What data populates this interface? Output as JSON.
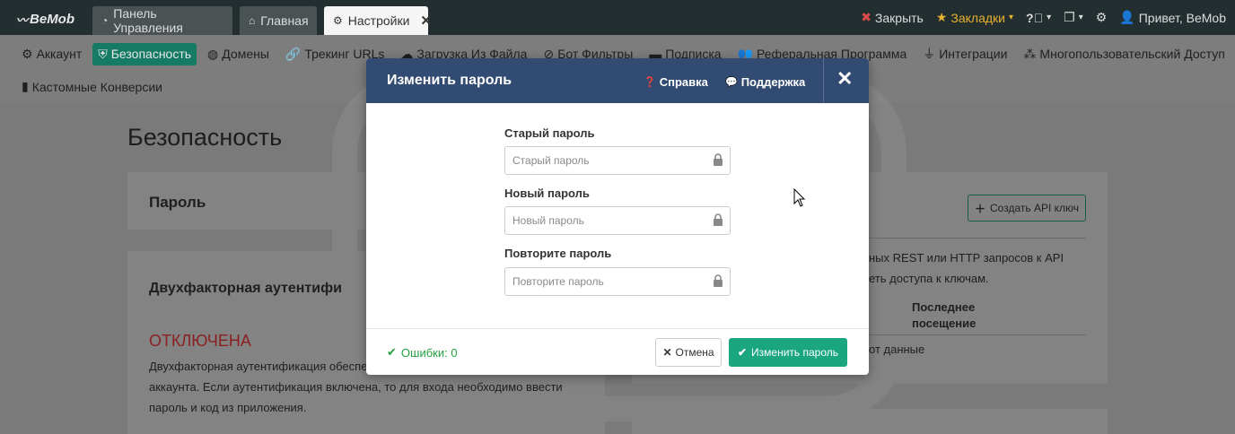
{
  "app": {
    "logo": "BeMob"
  },
  "tabs": [
    {
      "label": "Панель Управления",
      "icon": "dashboard-icon"
    },
    {
      "label": "Главная",
      "icon": "home-icon"
    },
    {
      "label": "Настройки",
      "icon": "gear-icon",
      "active": true
    }
  ],
  "topright": {
    "close_label": "Закрыть",
    "bookmarks_label": "Закладки",
    "greeting": "Привет, BeMob"
  },
  "subnav": [
    {
      "label": "Аккаунт",
      "icon": "gear-icon"
    },
    {
      "label": "Безопасность",
      "icon": "shield-icon",
      "active": true
    },
    {
      "label": "Домены",
      "icon": "globe-icon"
    },
    {
      "label": "Трекинг URLs",
      "icon": "link-icon"
    },
    {
      "label": "Загрузка Из Файла",
      "icon": "cloud-upload-icon"
    },
    {
      "label": "Бот Фильтры",
      "icon": "ban-icon"
    },
    {
      "label": "Подписка",
      "icon": "credit-card-icon"
    },
    {
      "label": "Реферальная Программа",
      "icon": "users-icon"
    },
    {
      "label": "Интеграции",
      "icon": "plug-icon"
    },
    {
      "label": "Многопользовательский Доступ",
      "icon": "sitemap-icon"
    },
    {
      "label": "Кастомные Конверсии",
      "icon": "file-icon"
    }
  ],
  "page": {
    "title": "Безопасность",
    "password_card_title": "Пароль",
    "twofa_title": "Двухфакторная аутентифи",
    "twofa_status": "ОТКЛЮЧЕНА",
    "twofa_text_1": "Двухфакторная аутентификация обеспе",
    "twofa_text_2": "аккаунта. Если аутентификация включена, то для входа необходимо ввести",
    "twofa_text_3": "пароль и код из приложения.",
    "api_button": "Создать API ключ",
    "api_text_1": "ных REST или HTTP запросов к API",
    "api_text_2": "еть доступа к ключам.",
    "api_col_last_1": "Последнее",
    "api_col_last_2": "посещение",
    "api_no_data": "от данные"
  },
  "modal": {
    "title": "Изменить пароль",
    "help_label": "Справка",
    "support_label": "Поддержка",
    "fields": [
      {
        "label": "Старый пароль",
        "placeholder": "Старый пароль",
        "value": ""
      },
      {
        "label": "Новый пароль",
        "placeholder": "Новый пароль",
        "value": ""
      },
      {
        "label": "Повторите пароль",
        "placeholder": "Повторите пароль",
        "value": ""
      }
    ],
    "errors_text": "Ошибки: 0",
    "cancel_label": "Отмена",
    "submit_label": "Изменить пароль"
  },
  "colors": {
    "header": "#324b72",
    "accent": "#1aa77f",
    "topbar": "#232e31",
    "success": "#26a041"
  }
}
